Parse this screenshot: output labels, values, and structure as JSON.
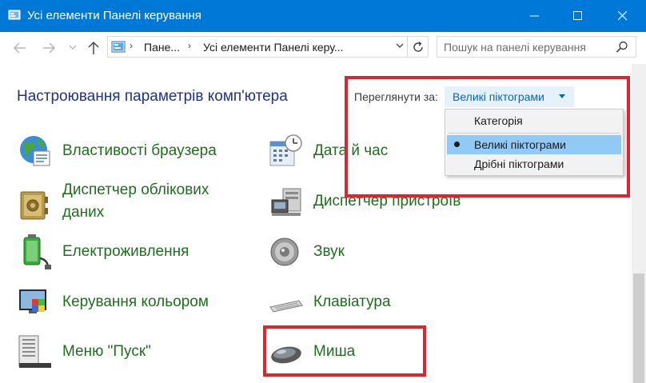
{
  "window": {
    "title": "Усі елементи Панелі керування",
    "icon": "control-panel-icon",
    "controls": [
      "minimize-icon",
      "maximize-icon",
      "close-icon"
    ]
  },
  "nav": {
    "back_icon": "arrow-left-icon",
    "forward_icon": "arrow-right-icon",
    "recent_icon": "chevron-down-icon",
    "up_icon": "arrow-up-icon",
    "breadcrumb": [
      "Пане...",
      "Усі елементи Панелі керу..."
    ],
    "refresh_icon": "refresh-icon"
  },
  "search": {
    "placeholder": "Пошук на панелі керування",
    "icon": "search-icon"
  },
  "page": {
    "heading": "Настроювання параметрів комп'ютера",
    "view_by_label": "Переглянути за:",
    "view_by_value": "Великі піктограми"
  },
  "view_menu": {
    "items": [
      "Категорія",
      "Великі піктограми",
      "Дрібні піктограми"
    ],
    "selected": "Великі піктограми"
  },
  "items": [
    {
      "label": "Властивості браузера",
      "icon": "internet-options-icon"
    },
    {
      "label": "Дата й час",
      "icon": "date-time-icon"
    },
    {
      "label": "Диспетчер облікових",
      "label2": "даних",
      "icon": "credential-manager-icon"
    },
    {
      "label": "Диспетчер пристроїв",
      "icon": "device-manager-icon"
    },
    {
      "label": "Електроживлення",
      "icon": "power-options-icon"
    },
    {
      "label": "Звук",
      "icon": "sound-icon"
    },
    {
      "label": "Керування кольором",
      "icon": "color-management-icon"
    },
    {
      "label": "Клавіатура",
      "icon": "keyboard-icon"
    },
    {
      "label": "Меню \"Пуск\"",
      "icon": "start-menu-icon"
    },
    {
      "label": "Миша",
      "icon": "mouse-icon"
    }
  ],
  "colors": {
    "titlebar": "#0078d7",
    "heading": "#1e3287",
    "item_label": "#1e6e1e",
    "link": "#0066cc",
    "highlight": "#e0242e",
    "menu_selected": "#91c9f7"
  }
}
